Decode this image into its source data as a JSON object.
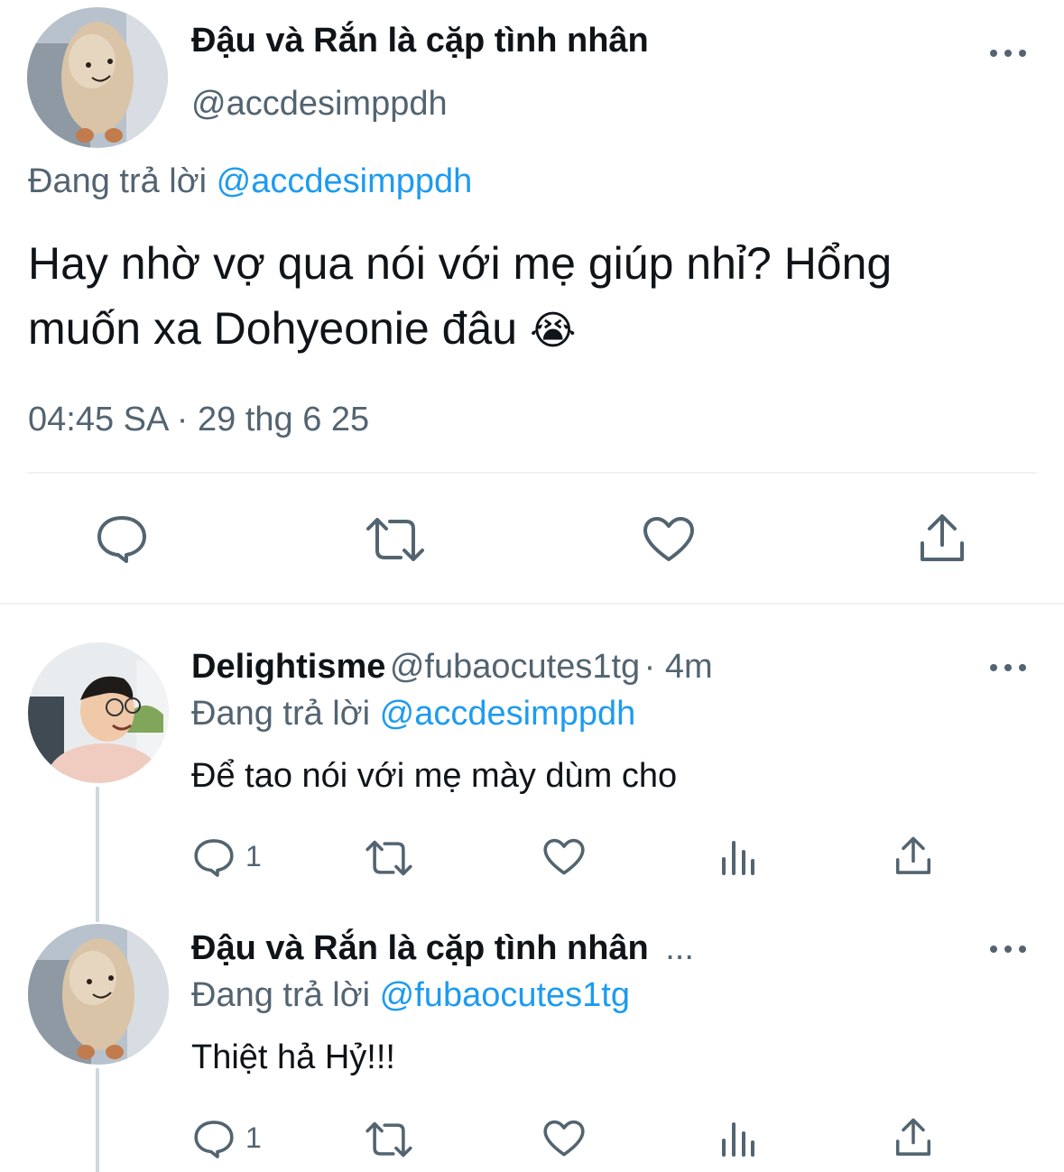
{
  "main_tweet": {
    "display_name": "Đậu và Rắn là cặp tình nhân",
    "handle": "@accdesimppdh",
    "replying_prefix": "Đang trả lời",
    "replying_to": "@accdesimppdh",
    "text_line1": "Hay nhờ vợ qua nói với mẹ giúp nhỉ? Hổng",
    "text_line2": "muốn xa Dohyeonie đâu",
    "emoji": "😭",
    "timestamp": "04:45 SA · 29 thg 6 25",
    "actions": [
      "reply-icon",
      "retweet-icon",
      "like-icon",
      "share-icon"
    ]
  },
  "replies": [
    {
      "display_name": "Delightisme",
      "handle": "@fubaocutes1tg",
      "time": "· 4m",
      "replying_prefix": "Đang trả lời",
      "replying_to": "@accdesimppdh",
      "text": "Để tao nói với mẹ mày dùm cho",
      "reply_count": "1",
      "actions": [
        "reply-icon",
        "retweet-icon",
        "like-icon",
        "views-icon",
        "share-icon"
      ]
    },
    {
      "display_name": "Đậu và Rắn là cặp tình nhân",
      "handle_truncated": "...",
      "replying_prefix": "Đang trả lời",
      "replying_to": "@fubaocutes1tg",
      "text": "Thiệt hả Hỷ!!!",
      "reply_count": "1",
      "actions": [
        "reply-icon",
        "retweet-icon",
        "like-icon",
        "views-icon",
        "share-icon"
      ]
    }
  ],
  "colors": {
    "text": "#0f1419",
    "secondary": "#536471",
    "link": "#1d9bf0",
    "divider": "#eff3f4"
  }
}
